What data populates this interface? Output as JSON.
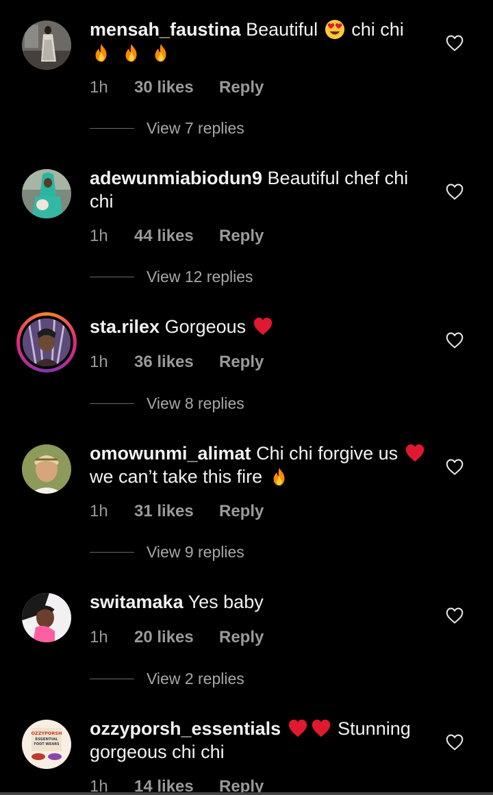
{
  "comments": [
    {
      "username": "mensah_faustina",
      "text_parts": [
        "Beautiful",
        "chi chi"
      ],
      "emojis": [
        "heart-eyes-emoji",
        "fire-emoji",
        "fire-emoji",
        "fire-emoji"
      ],
      "time": "1h",
      "likes": "30 likes",
      "reply": "Reply",
      "view_replies": "View 7 replies"
    },
    {
      "username": "adewunmiabiodun9",
      "text_line1": "Beautiful chef chi",
      "text_line2": "chi",
      "time": "1h",
      "likes": "44 likes",
      "reply": "Reply",
      "view_replies": "View 12 replies"
    },
    {
      "username": "sta.rilex",
      "text": "Gorgeous",
      "emojis": [
        "red-heart-emoji"
      ],
      "time": "1h",
      "likes": "36 likes",
      "reply": "Reply",
      "view_replies": "View 8 replies"
    },
    {
      "username": "omowunmi_alimat",
      "text_line1": "Chi chi forgive us",
      "text_line2": "we can’t take this fire",
      "emojis": [
        "red-heart-emoji",
        "fire-emoji"
      ],
      "time": "1h",
      "likes": "31 likes",
      "reply": "Reply",
      "view_replies": "View 9 replies"
    },
    {
      "username": "switamaka",
      "text": "Yes baby",
      "time": "1h",
      "likes": "20 likes",
      "reply": "Reply",
      "view_replies": "View 2 replies"
    },
    {
      "username": "ozzyporsh_essentials",
      "text_line1": "Stunning",
      "text_line2": "gorgeous chi chi",
      "emojis": [
        "red-heart-emoji",
        "red-heart-emoji"
      ],
      "time": "1h",
      "likes": "14 likes",
      "reply": "Reply",
      "avatar_logo_lines": [
        "OZZYPORSH",
        "ESSENTIAL",
        "FOOT WEARS"
      ]
    }
  ],
  "icons": {
    "like": "heart-outline-icon",
    "story_ring_colors": [
      "#f58529",
      "#dd2a7b",
      "#8134af"
    ]
  },
  "colors": {
    "background": "#000000",
    "text": "#f2f2f2",
    "meta": "#9a9a9a",
    "heart": "#e0192f",
    "fire": "#ff8a00"
  }
}
